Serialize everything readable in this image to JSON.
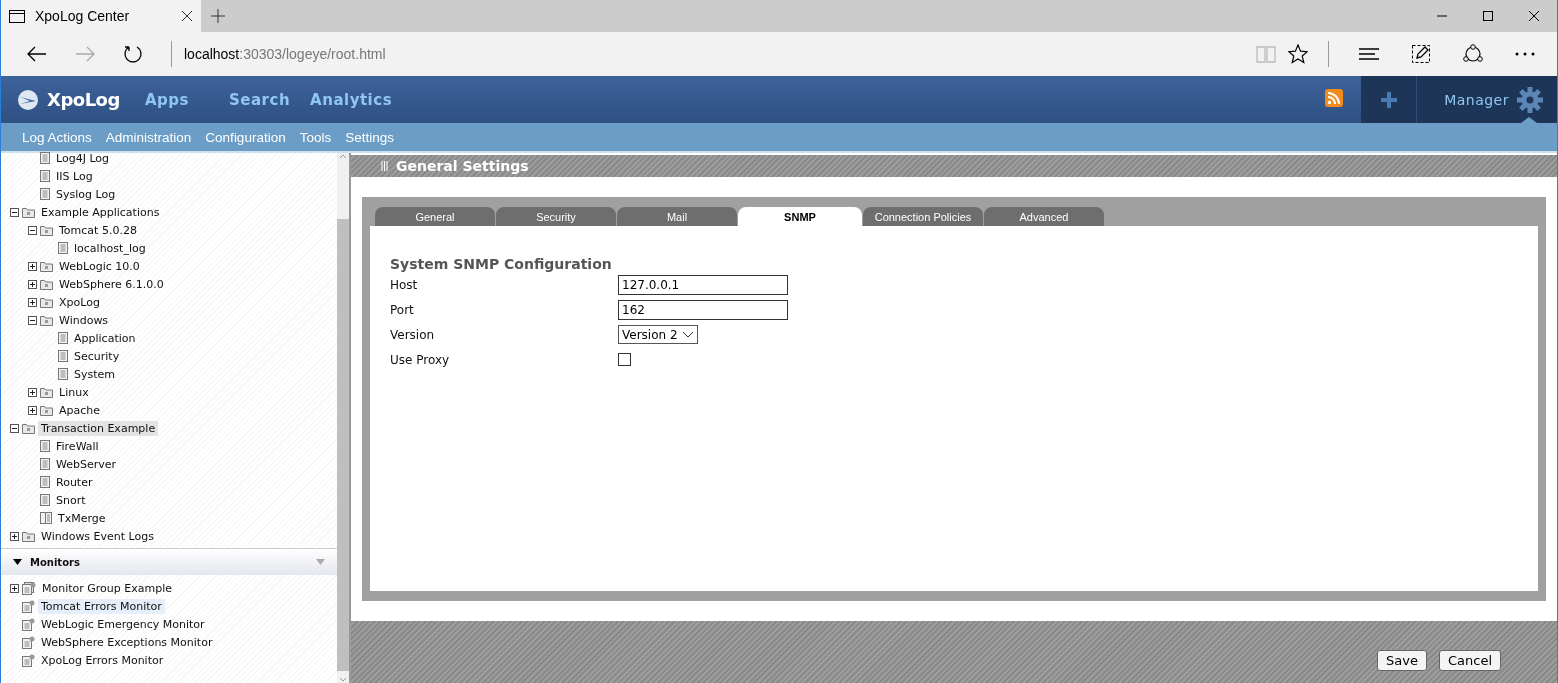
{
  "browser": {
    "tab_title": "XpoLog Center",
    "url_host": "localhost",
    "url_path": ":30303/logeye/root.html"
  },
  "header": {
    "logo": "XpoLog",
    "nav": [
      "Apps",
      "Search",
      "Analytics"
    ],
    "user": "Manager"
  },
  "menu": [
    "Log Actions",
    "Administration",
    "Configuration",
    "Tools",
    "Settings"
  ],
  "tree": [
    {
      "children": [
        {
          "label": "Log4J Log",
          "kind": "log",
          "selected": false
        },
        {
          "label": "IIS Log",
          "kind": "log",
          "selected": false
        },
        {
          "label": "Syslog Log",
          "kind": "log",
          "selected": false
        }
      ]
    },
    {
      "label": "Example Applications",
      "kind": "folder",
      "expanded": true,
      "selected": false,
      "children": [
        {
          "label": "Tomcat 5.0.28",
          "kind": "folder",
          "expanded": true,
          "selected": false,
          "children": [
            {
              "label": "localhost_log",
              "kind": "log",
              "selected": false
            }
          ]
        },
        {
          "label": "WebLogic 10.0",
          "kind": "folder",
          "expanded": false,
          "selected": false
        },
        {
          "label": "WebSphere 6.1.0.0",
          "kind": "folder",
          "expanded": false,
          "selected": false
        },
        {
          "label": "XpoLog",
          "kind": "folder",
          "expanded": false,
          "selected": false
        },
        {
          "label": "Windows",
          "kind": "folder",
          "expanded": true,
          "selected": false,
          "children": [
            {
              "label": "Application",
              "kind": "log",
              "selected": false
            },
            {
              "label": "Security",
              "kind": "log",
              "selected": false
            },
            {
              "label": "System",
              "kind": "log",
              "selected": false
            }
          ]
        },
        {
          "label": "Linux",
          "kind": "folder",
          "expanded": false,
          "selected": false
        },
        {
          "label": "Apache",
          "kind": "folder",
          "expanded": false,
          "selected": false
        }
      ]
    },
    {
      "label": "Transaction Example",
      "kind": "folder",
      "expanded": true,
      "selected": true,
      "children": [
        {
          "label": "FireWall",
          "kind": "log",
          "selected": false
        },
        {
          "label": "WebServer",
          "kind": "log",
          "selected": false
        },
        {
          "label": "Router",
          "kind": "log",
          "selected": false
        },
        {
          "label": "Snort",
          "kind": "log",
          "selected": false
        },
        {
          "label": "TxMerge",
          "kind": "merge",
          "selected": false
        }
      ]
    },
    {
      "label": "Windows Event Logs",
      "kind": "folder",
      "expanded": false,
      "selected": false
    }
  ],
  "monitors": {
    "title": "Monitors",
    "items": [
      {
        "label": "Monitor Group Example",
        "kind": "group",
        "expanded": false,
        "selected": false
      },
      {
        "label": "Tomcat Errors Monitor",
        "kind": "monitor",
        "selected": true
      },
      {
        "label": "WebLogic Emergency Monitor",
        "kind": "monitor",
        "selected": false
      },
      {
        "label": "WebSphere Exceptions Monitor",
        "kind": "monitor",
        "selected": false
      },
      {
        "label": "XpoLog Errors Monitor",
        "kind": "monitor",
        "selected": false
      }
    ]
  },
  "panel": {
    "title": "General Settings",
    "tabs": [
      {
        "label": "General",
        "selected": false
      },
      {
        "label": "Security",
        "selected": false
      },
      {
        "label": "Mail",
        "selected": false
      },
      {
        "label": "SNMP",
        "selected": true
      },
      {
        "label": "Connection Policies",
        "selected": false
      },
      {
        "label": "Advanced",
        "selected": false
      }
    ],
    "section_title": "System SNMP Configuration",
    "fields": [
      {
        "label": "Host",
        "kind": "text",
        "value": "127.0.0.1"
      },
      {
        "label": "Port",
        "kind": "text",
        "value": "162"
      },
      {
        "label": "Version",
        "kind": "select",
        "value": "Version 2"
      },
      {
        "label": "Use Proxy",
        "kind": "checkbox",
        "checked": false
      }
    ],
    "buttons": [
      "Save",
      "Cancel"
    ]
  }
}
